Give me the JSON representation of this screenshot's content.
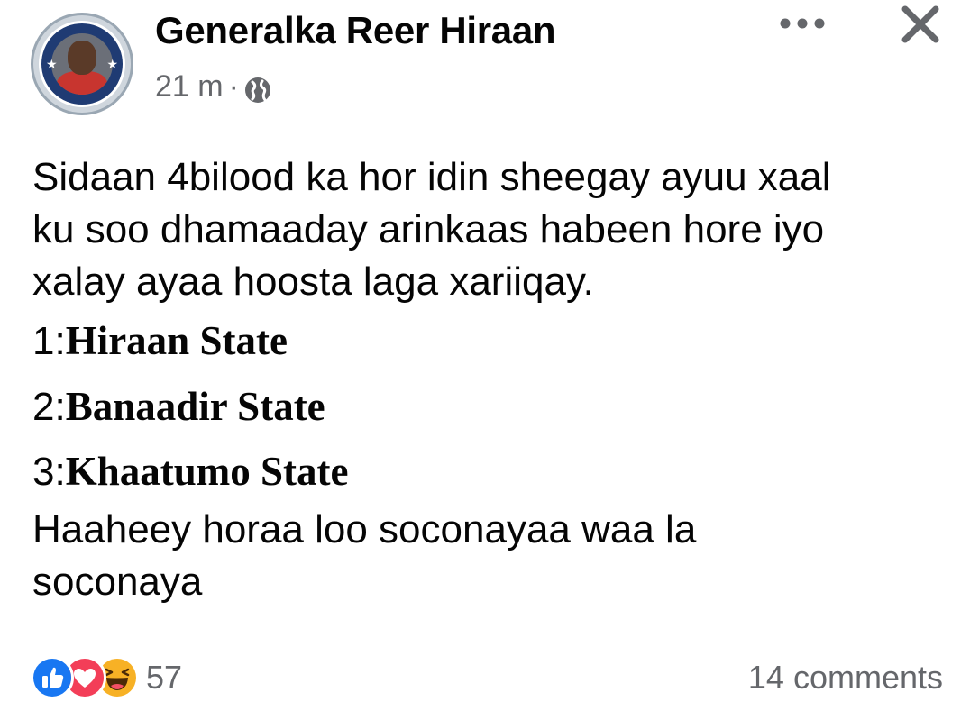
{
  "post": {
    "author": "Generalka Reer Hiraan",
    "time": "21 m",
    "separator": "·",
    "audience_icon": "globe-icon",
    "avatar_icon": "profile-avatar",
    "lines": [
      "Sidaan 4bilood ka hor idin sheegay ayuu xaal",
      "ku soo dhamaaday arinkaas habeen hore iyo",
      "xalay ayaa hoosta laga xariiqay."
    ],
    "list": [
      {
        "prefix": "1:",
        "name": "Hiraan State"
      },
      {
        "prefix": "2:",
        "name": "Banaadir State"
      },
      {
        "prefix": "3:",
        "name": "Khaatumo State"
      }
    ],
    "closing_lines": [
      "Haaheey horaa loo soconayaa waa la",
      "soconaya"
    ]
  },
  "header_actions": {
    "more_icon": "more-horizontal-icon",
    "close_icon": "close-icon"
  },
  "footer": {
    "reaction_icons": [
      "like-icon",
      "love-icon",
      "haha-icon"
    ],
    "reaction_count": "57",
    "comments": "14 comments"
  },
  "colors": {
    "text_primary": "#050505",
    "text_secondary": "#65676b",
    "like_blue": "#1877f2",
    "love_red": "#f33e58",
    "haha_yellow": "#f7b125"
  }
}
